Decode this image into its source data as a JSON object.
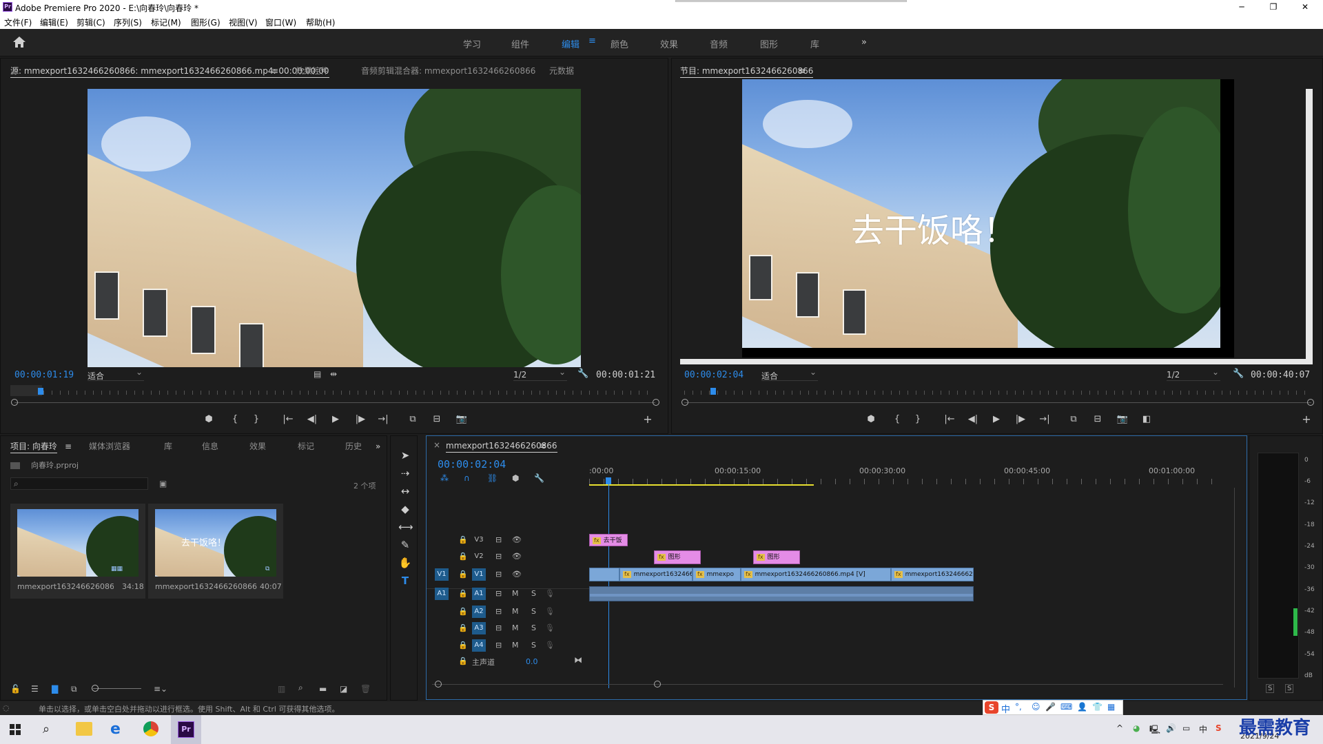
{
  "window": {
    "title": "Adobe Premiere Pro 2020 - E:\\向春玲\\向春玲 *",
    "app_icon": "Pr",
    "minimize": "─",
    "maximize": "❐",
    "close": "✕"
  },
  "menu": [
    "文件(F)",
    "编辑(E)",
    "剪辑(C)",
    "序列(S)",
    "标记(M)",
    "图形(G)",
    "视图(V)",
    "窗口(W)",
    "帮助(H)"
  ],
  "workspaces": {
    "items": [
      "学习",
      "组件",
      "编辑",
      "颜色",
      "效果",
      "音频",
      "图形",
      "库"
    ],
    "active": "编辑",
    "more": "»",
    "menu_icon": "≡"
  },
  "source": {
    "tabs": [
      "源: mmexport1632466260866: mmexport1632466260866.mp4: 00:00:00:00",
      "效果控件",
      "音频剪辑混合器: mmexport1632466260866",
      "元数据"
    ],
    "timecode": "00:00:01:19",
    "fit": "适合",
    "quality": "1/2",
    "duration": "00:00:01:21"
  },
  "program": {
    "tab": "节目: mmexport1632466260866",
    "title_text": "去干饭咯！",
    "timecode": "00:00:02:04",
    "fit": "适合",
    "quality": "1/2",
    "duration": "00:00:40:07"
  },
  "project": {
    "tabs": [
      "项目: 向春玲",
      "媒体浏览器",
      "库",
      "信息",
      "效果",
      "标记",
      "历史"
    ],
    "file": "向春玲.prproj",
    "count": "2 个项",
    "items": [
      {
        "name": "mmexport1632466260866...",
        "dur": "34:18"
      },
      {
        "name": "mmexport1632466260866",
        "dur": "40:07",
        "overlay": "去干饭咯！"
      }
    ]
  },
  "timeline": {
    "tab": "mmexport1632466260866",
    "close": "×",
    "timecode": "00:00:02:04",
    "ruler": [
      ":00:00",
      "00:00:15:00",
      "00:00:30:00",
      "00:00:45:00",
      "00:01:00:00"
    ],
    "video_tracks": [
      {
        "label": "V3"
      },
      {
        "label": "V2"
      },
      {
        "src": "V1",
        "label": "V1"
      }
    ],
    "audio_tracks": [
      {
        "src": "A1",
        "label": "A1"
      },
      {
        "label": "A2"
      },
      {
        "label": "A3"
      },
      {
        "label": "A4"
      }
    ],
    "master": {
      "label": "主声道",
      "value": "0.0"
    },
    "mute": "M",
    "solo": "S",
    "clips": {
      "v3": "去干饭",
      "v2a": "图形",
      "v2b": "图形",
      "v1a": "mmexport1632466",
      "v1b": "mmexpo",
      "v1c": "mmexport1632466260866.mp4 [V]",
      "v1d": "mmexport1632466626"
    },
    "fx": "fx"
  },
  "meter": {
    "ticks": [
      "0",
      "-6",
      "-12",
      "-18",
      "-24",
      "-30",
      "-36",
      "-42",
      "-48",
      "-54",
      "dB"
    ],
    "solo_left": "S",
    "solo_right": "S"
  },
  "status": {
    "text": "单击以选择，或单击空白处并拖动以进行框选。使用 Shift、Alt 和 Ctrl 可获得其他选项。"
  },
  "ime": [
    "中",
    "°,",
    "☺",
    "🎤",
    "⌨",
    "👤",
    "👕",
    "▦"
  ],
  "taskbar": {
    "date": "2021/9/24",
    "watermark": "最需教育",
    "pr_label": "Pr"
  }
}
